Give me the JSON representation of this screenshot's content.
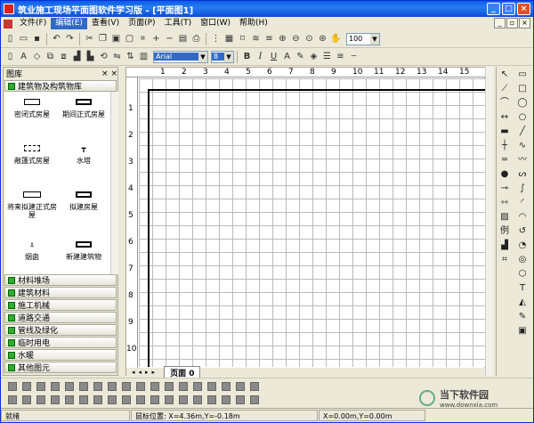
{
  "title": "筑业施工现场平面图软件学习版 - [平面图1]",
  "window_buttons": [
    "_",
    "□",
    "×"
  ],
  "mdi_buttons": [
    "_",
    "▫",
    "×"
  ],
  "menu": [
    {
      "label": "文件(F)"
    },
    {
      "label": "编辑(E)",
      "active": true
    },
    {
      "label": "查看(V)"
    },
    {
      "label": "页面(P)"
    },
    {
      "label": "工具(T)"
    },
    {
      "label": "窗口(W)"
    },
    {
      "label": "帮助(H)"
    }
  ],
  "toolbar1": {
    "zoom": "100"
  },
  "toolbar2": {
    "font": "Arial",
    "size": "8"
  },
  "panel": {
    "title": "图库",
    "close": "× ×",
    "active_category": "建筑物及构筑物库"
  },
  "library_items": [
    {
      "label": "密闭式房屋"
    },
    {
      "label": "期间正式房屋"
    },
    {
      "label": "敞篷式房屋"
    },
    {
      "label": "水塔"
    },
    {
      "label": "将来拟建正式房屋"
    },
    {
      "label": "拟建房屋"
    },
    {
      "label": "烟囱"
    },
    {
      "label": "新建建筑物"
    }
  ],
  "categories": [
    "材料堆场",
    "建筑材料",
    "施工机械",
    "道路交通",
    "管线及绿化",
    "临时用电",
    "水暖",
    "其他图元"
  ],
  "ruler_h": [
    "1",
    "2",
    "3",
    "4",
    "5",
    "6",
    "7",
    "8",
    "9",
    "10",
    "11",
    "12",
    "13",
    "14",
    "15"
  ],
  "ruler_v": [
    "1",
    "2",
    "3",
    "4",
    "5",
    "6",
    "7",
    "8",
    "9",
    "10"
  ],
  "page_tab": "页面  0",
  "status": {
    "ready": "就绪",
    "position_label": "鼠标位置:",
    "position": "X=4.36m,Y=-0.18m",
    "coords": "X=0.00m,Y=0.00m"
  },
  "watermark": {
    "name": "当下软件园",
    "url": "www.downxia.com"
  },
  "colors": {
    "title_start": "#0a5ee8",
    "title_end": "#0a4fd6",
    "menu_active": "#316ac5"
  }
}
